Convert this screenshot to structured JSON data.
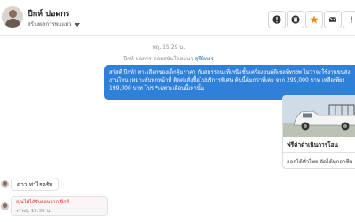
{
  "header": {
    "contact_name": "ปีกห์ ปอดกร",
    "contact_sub": "สร้างผลการพบแมว",
    "buttons": [
      {
        "name": "info-icon",
        "glyph": "!"
      },
      {
        "name": "delete-icon",
        "glyph": "trash"
      },
      {
        "name": "star-icon",
        "glyph": "star"
      },
      {
        "name": "mail-icon",
        "glyph": "mail"
      },
      {
        "name": "alert-icon",
        "glyph": "!"
      }
    ],
    "more": "⋮"
  },
  "chat": {
    "timestamp": "พฤ, 15:29 น.",
    "system_note_prefix": "ปีกห์ ปอดกร ตอบสนับโดยแนว",
    "system_note_agent": "สุรีย์ทอร",
    "outgoing_message": "สวัสดี ปีกห์! ทางเลือกของเด็กคุ้มราคา กับสมรรถนะที่เหนือชั้นเครื่องยนต์ดีเซลที่ทรงพ ไม่ว่าจะใช้งานขนส่ง งานไหน เหมาะกับทุกหน้าที่ ติดต่อสั่งซื้อไปบริการพิเศษ ค้นนี้คุ้มกว่าที่เคย จาก 299,000 บาท เหลือเพียง 199,000 บาท โปร *เฉพาะเดือนนี้เท่านั้น",
    "card": {
      "title": "ฟรีค่าดำเนินการโอน",
      "subtitle": "ออกได้ทั่วไทย จัดได้ทุกอาชีพ"
    },
    "incoming_message": "ดาวเท่าไรครับ",
    "reply": {
      "line1": "คุณไม่ได้รับตอบจาก ปีกห์",
      "check": "✓",
      "line2": "พฤ, 15:30 น."
    }
  },
  "colors": {
    "accent": "#2f80d8",
    "star": "#f28b1e",
    "reply_label": "#d0312d"
  }
}
